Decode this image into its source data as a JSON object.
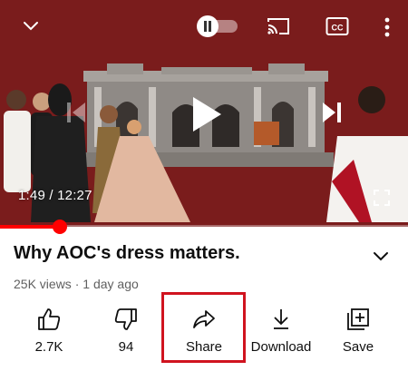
{
  "player": {
    "time_current": "1:49",
    "time_separator": " / ",
    "time_total": "12:27",
    "progress": 0.146,
    "background_color": "#7a1c1c",
    "progress_color": "#ff0000",
    "cc_label": "CC",
    "icons": {
      "minimize": "chevron-down-icon",
      "pause": "pause-icon",
      "cast": "cast-icon",
      "captions": "closed-captions-icon",
      "more": "more-vert-icon",
      "previous": "skip-previous-icon",
      "play": "play-icon",
      "next": "skip-next-icon",
      "fullscreen": "fullscreen-icon"
    }
  },
  "video": {
    "title": "Why AOC's dress matters.",
    "views": "25K views",
    "separator": " · ",
    "age": "1 day ago"
  },
  "actions": [
    {
      "id": "like",
      "label": "2.7K",
      "icon": "thumbs-up-icon"
    },
    {
      "id": "dislike",
      "label": "94",
      "icon": "thumbs-down-icon"
    },
    {
      "id": "share",
      "label": "Share",
      "icon": "share-icon",
      "highlighted": true
    },
    {
      "id": "download",
      "label": "Download",
      "icon": "download-icon"
    },
    {
      "id": "save",
      "label": "Save",
      "icon": "playlist-add-icon"
    }
  ],
  "highlight_color": "#d0131f"
}
